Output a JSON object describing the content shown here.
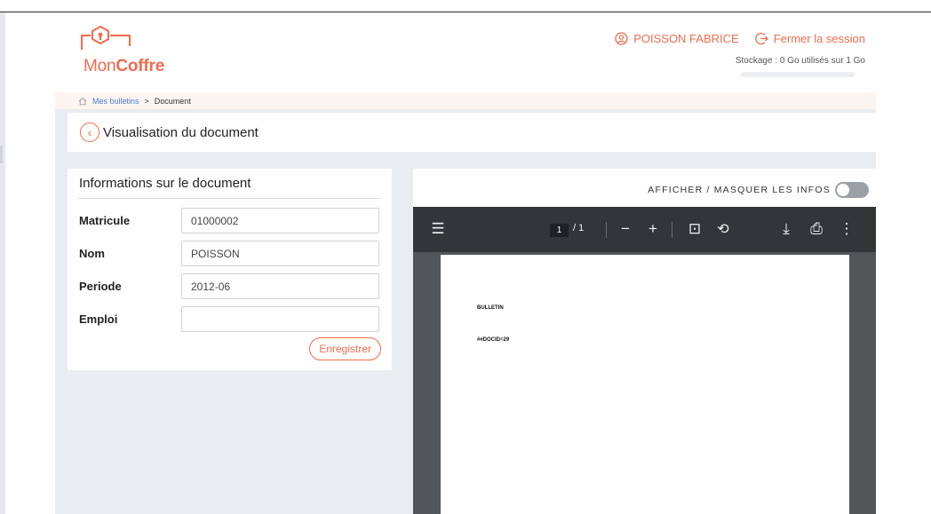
{
  "brand": {
    "logo_text_light": "Mon",
    "logo_text_bold": "Coffre",
    "accent_color": "#ef6c4f"
  },
  "header": {
    "user_name": "POISSON FABRICE",
    "logout_label": "Fermer la session",
    "storage_text": "Stockage : 0 Go utilisés sur 1 Go",
    "storage_used_fraction": 0
  },
  "breadcrumb": {
    "home_icon": "home-icon",
    "parent": "Mes bulletins",
    "separator": ">",
    "current": "Document"
  },
  "page": {
    "title": "Visualisation du document"
  },
  "info": {
    "heading": "Informations sur le document",
    "fields": [
      {
        "label": "Matricule",
        "value": "01000002"
      },
      {
        "label": "Nom",
        "value": "POISSON"
      },
      {
        "label": "Periode",
        "value": "2012-06"
      },
      {
        "label": "Emploi",
        "value": ""
      }
    ],
    "save_label": "Enregistrer"
  },
  "viewer": {
    "toggle_label": "AFFICHER / MASQUER LES INFOS",
    "toggle_on": false,
    "toolbar": {
      "menu_icon": "☰",
      "current_page": "1",
      "total_pages": "/ 1",
      "zoom_out": "−",
      "zoom_in": "+",
      "fit_icon": "⊡",
      "rotate_icon": "⟲",
      "download_icon": "⤓",
      "print_icon": "⎙",
      "more_icon": "⋮"
    },
    "document": {
      "line1": "BULLETIN",
      "line2": "##DOCID=29"
    }
  }
}
